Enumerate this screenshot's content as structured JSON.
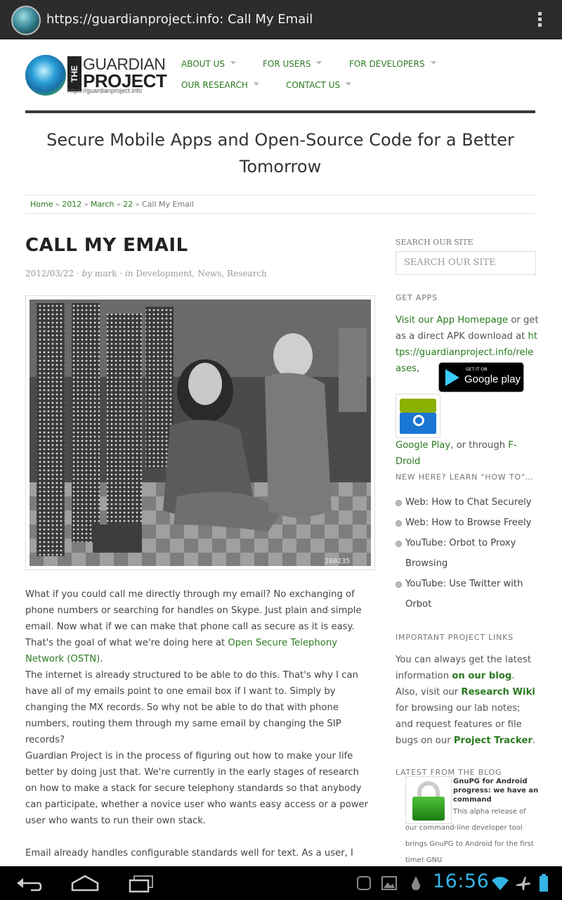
{
  "browser": {
    "url_title": "https://guardianproject.info: Call My Email"
  },
  "logo": {
    "the": "THE",
    "line1": "GUARDIAN",
    "line2": "PROJECT",
    "url": "https://guardianproject.info"
  },
  "nav": {
    "items": [
      {
        "label": "ABOUT US"
      },
      {
        "label": "FOR USERS"
      },
      {
        "label": "FOR DEVELOPERS"
      },
      {
        "label": "OUR RESEARCH"
      },
      {
        "label": "CONTACT US"
      }
    ]
  },
  "tagline": "Secure Mobile Apps and Open-Source Code for a Better Tomorrow",
  "breadcrumb": {
    "home": "Home",
    "year": "2012",
    "month": "March",
    "day": "22",
    "current": "Call My Email",
    "sep": "»"
  },
  "post": {
    "title": "CALL MY EMAIL",
    "date": "2012/03/22",
    "by": "by",
    "author": "mark",
    "in": "in",
    "categories": [
      "Development",
      "News",
      "Research"
    ],
    "photo_caption": "260235",
    "p1_text": "What if you could call me directly through my email? No exchanging of phone numbers or searching for handles on Skype. Just plain and simple email. Now what if we can make that phone call as secure as it is easy. That's the goal of what we're doing here at ",
    "p1_link": "Open Secure Telephony Network (OSTN)",
    "p1_end": ".",
    "p2": "The internet is already structured to be able to do this. That's why I can have all of my emails point to one email box if I want to. Simply by changing the MX records. So why not be able to do that with phone numbers, routing them through my same email by changing the SIP records?",
    "p3": "Guardian Project is in the process of figuring out how to make your life better by doing just that. We're currently in the early stages of research on how to make a stack for secure telephony standards so that anybody can participate, whether a novice user who wants easy access or a power user who wants to run their own stack.",
    "p4": "Email already handles configurable standards well for text. As a user, I can"
  },
  "sidebar": {
    "search_heading": "SEARCH OUR SITE",
    "search_placeholder": "SEARCH OUR SITE",
    "apps_heading": "GET APPS",
    "apps_link1": "Visit our App Homepage",
    "apps_text1": " or get as a direct APK download at ",
    "apps_link2": "https://guardianproject.info/releases",
    "apps_comma": ",",
    "gplay_small": "GET IT ON",
    "gplay_big": "Google play",
    "apps_link3": "Google Play",
    "apps_text2": ", or through ",
    "apps_link4": "F-Droid",
    "howto_heading": "NEW HERE? LEARN \"HOW TO\"…",
    "howto_items": [
      "Web: How to Chat Securely",
      "Web: How to Browse Freely",
      "YouTube: Orbot to Proxy Browsing",
      "YouTube: Use Twitter with Orbot"
    ],
    "links_heading": "IMPORTANT PROJECT LINKS",
    "links_t1": "You can always get the latest information ",
    "links_a1": "on our blog",
    "links_t2": ". Also, visit our ",
    "links_a2": "Research Wiki",
    "links_t3": " for browsing our lab notes; and request features or file bugs on our ",
    "links_a3": "Project Tracker",
    "links_t4": ".",
    "blog_heading": "LATEST FROM THE BLOG",
    "blog_title": "GnuPG for Android progress: we have an command",
    "blog_excerpt": "This alpha release of our command-line developer tool brings GnuPG to Android for the first time! GNU"
  },
  "system": {
    "clock": "16:56"
  },
  "colors": {
    "link": "#2a7a1f",
    "clock": "#33b5e5"
  }
}
